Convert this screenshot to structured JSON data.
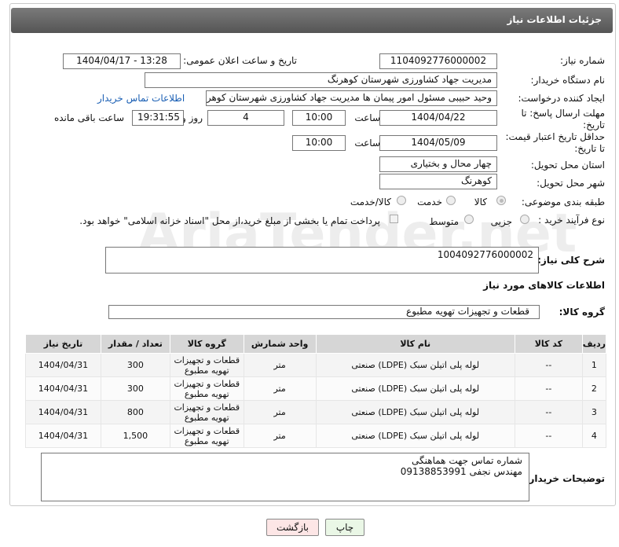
{
  "header": {
    "title": "جزئیات اطلاعات نیاز"
  },
  "fields": {
    "need_number_label": "شماره نیاز:",
    "need_number": "1104092776000002",
    "announce_label": "تاریخ و ساعت اعلان عمومی:",
    "announce_value": "1404/04/17 - 13:28",
    "buyer_label": "نام دستگاه خریدار:",
    "buyer_value": "مدیریت جهاد کشاورزی شهرستان کوهرنگ",
    "creator_label": "ایجاد کننده درخواست:",
    "creator_value": "وحید حبیبی مسئول امور پیمان ها مدیریت جهاد کشاورزی شهرستان کوهرنگ",
    "contact_link": "اطلاعات تماس خریدار",
    "deadline_label_1": "مهلت ارسال پاسخ: تا",
    "deadline_label_2": "تاریخ:",
    "deadline_date": "1404/04/22",
    "time_label": "ساعت",
    "deadline_time": "10:00",
    "days_value": "4",
    "days_label": "روز و",
    "remaining_value": "19:31:55",
    "remaining_label": "ساعت باقی مانده",
    "validity_label_1": "حداقل تاریخ اعتبار قیمت:",
    "validity_label_2": "تا تاریخ:",
    "validity_date": "1404/05/09",
    "validity_time": "10:00",
    "province_label": "استان محل تحویل:",
    "province_value": "چهار محال و بختیاری",
    "city_label": "شهر محل تحویل:",
    "city_value": "کوهرنگ",
    "category_label": "طبقه بندی موضوعی:",
    "category_options": [
      "کالا",
      "خدمت",
      "کالا/خدمت"
    ],
    "category_selected": "کالا",
    "process_label": "نوع فرآیند خرید :",
    "process_options": [
      "جزیی",
      "متوسط"
    ],
    "process_note": "پرداخت تمام یا بخشی از مبلغ خرید،از محل \"اسناد خزانه اسلامی\" خواهد بود."
  },
  "description": {
    "label": "شرح کلی نیاز:",
    "value": "1004092776000002"
  },
  "goods_section": {
    "title": "اطلاعات کالاهای مورد نیاز",
    "group_label": "گروه کالا:",
    "group_value": "قطعات و تجهیزات تهویه مطبوع"
  },
  "table": {
    "headers": [
      "ردیف",
      "کد کالا",
      "نام کالا",
      "واحد شمارش",
      "گروه کالا",
      "تعداد / مقدار",
      "تاریخ نیاز"
    ],
    "rows": [
      {
        "row": "1",
        "code": "--",
        "name": "لوله پلی اتیلن سبک (LDPE) صنعتی",
        "unit": "متر",
        "group": "قطعات و تجهیزات تهویه مطبوع",
        "qty": "300",
        "date": "1404/04/31"
      },
      {
        "row": "2",
        "code": "--",
        "name": "لوله پلی اتیلن سبک (LDPE) صنعتی",
        "unit": "متر",
        "group": "قطعات و تجهیزات تهویه مطبوع",
        "qty": "300",
        "date": "1404/04/31"
      },
      {
        "row": "3",
        "code": "--",
        "name": "لوله پلی اتیلن سبک (LDPE) صنعتی",
        "unit": "متر",
        "group": "قطعات و تجهیزات تهویه مطبوع",
        "qty": "800",
        "date": "1404/04/31"
      },
      {
        "row": "4",
        "code": "--",
        "name": "لوله پلی اتیلن سبک (LDPE) صنعتی",
        "unit": "متر",
        "group": "قطعات و تجهیزات تهویه مطبوع",
        "qty": "1,500",
        "date": "1404/04/31"
      }
    ]
  },
  "buyer_notes": {
    "label": "توضیحات خریدار:",
    "line1": "شماره تماس جهت هماهنگی",
    "line2": "مهندس نجفی 09138853991"
  },
  "buttons": {
    "print": "چاپ",
    "back": "بازگشت"
  },
  "watermark": "AriaTender.net"
}
